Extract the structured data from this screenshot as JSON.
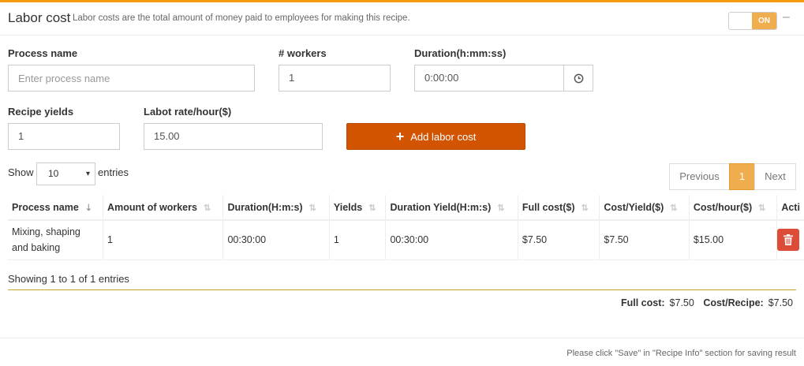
{
  "header": {
    "title": "Labor cost",
    "subtitle": "Labor costs are the total amount of money paid to employees for making this recipe.",
    "toggle_label": "ON",
    "collapse_symbol": "–"
  },
  "form": {
    "process_name_label": "Process name",
    "process_name_placeholder": "Enter process name",
    "workers_label": "# workers",
    "workers_value": "1",
    "duration_label": "Duration(h:mm:ss)",
    "duration_value": "0:00:00",
    "recipe_yields_label": "Recipe yields",
    "recipe_yields_value": "1",
    "labor_rate_label": "Labot rate/hour($)",
    "labor_rate_value": "15.00",
    "add_button_label": "Add labor cost"
  },
  "table_controls": {
    "show_label": "Show",
    "page_size": "10",
    "entries_label": "entries",
    "previous_label": "Previous",
    "current_page": "1",
    "next_label": "Next"
  },
  "table": {
    "columns": [
      "Process name",
      "Amount of workers",
      "Duration(H:m:s)",
      "Yields",
      "Duration Yield(H:m:s)",
      "Full cost($)",
      "Cost/Yield($)",
      "Cost/hour($)",
      "Acti"
    ],
    "rows": [
      [
        "Mixing, shaping and baking",
        "1",
        "00:30:00",
        "1",
        "00:30:00",
        "$7.50",
        "$7.50",
        "$15.00"
      ]
    ]
  },
  "summary": {
    "showing_text": "Showing 1 to 1 of 1 entries",
    "full_cost_label": "Full cost:",
    "full_cost_value": "$7.50",
    "cost_recipe_label": "Cost/Recipe:",
    "cost_recipe_value": "$7.50"
  },
  "footer": {
    "note": "Please click \"Save\" in \"Recipe Info\" section for saving result"
  },
  "colors": {
    "accent": "#f39c12",
    "toggle_on": "#f0ad4e",
    "add_button": "#d35400",
    "delete_button": "#dd4b39",
    "divider": "#c9a227"
  }
}
